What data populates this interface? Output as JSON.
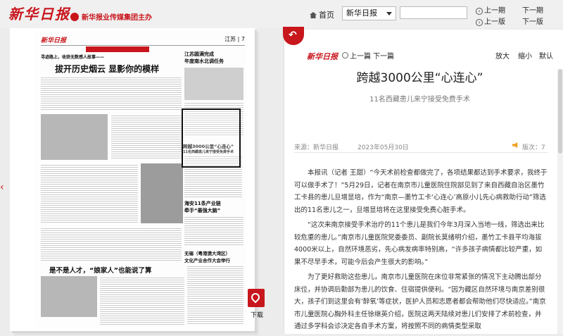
{
  "header": {
    "logo_text": "新华日报",
    "brand_text": "新华报业传媒集团主办",
    "home_label": "首页",
    "paper_select_value": "新华日报",
    "search_placeholder": "",
    "prev_issue": "上一期",
    "next_issue": "下一期",
    "prev_page": "上一版",
    "next_page": "下一版"
  },
  "newspaper": {
    "logo_text": "新华日报",
    "section_label": "江苏",
    "page_number": "7",
    "headline_main": "拔开历史烟云 显影你的模样",
    "headline_top": "寻迹路上，收获无数感人故事——",
    "headline_right1": "江苏圆满完成",
    "headline_right2": "年度南水北调任务",
    "highlight_title": "跨越3000公里“心连心”",
    "highlight_sub": "11名西藏患儿来宁接受免费手术",
    "headline_mid": "海安11条产业链",
    "headline_mid2": "牵手“最强大脑”",
    "headline_low1": "无锡（粤港澳大湾区）",
    "headline_low2": "文化产业合作大会举行",
    "headline_bottom": "是不是人才，“娘家人”也能说了算",
    "download_label": "下载"
  },
  "article": {
    "panel_logo": "新华日报",
    "prev_article": "上一篇",
    "next_article": "下一篇",
    "zoom_in": "放大",
    "zoom_out": "缩小",
    "reset": "默认",
    "title": "跨越3000公里“心连心”",
    "subtitle": "11名西藏患儿来宁接受免费手术",
    "source": "来源：新华日报",
    "date": "2023年05月30日",
    "edition": "版次：7",
    "paragraphs": [
      "本报讯（记者 王甜）“今天术前检查都做完了，各项结果都达到手术要求，我终于可以做手术了！”5月29日，记者在南京市儿童医院住院部见到了来自西藏自治区墨竹工卡县的患儿旦增显培，作为“南京—墨竹工卡‘心连心’高原小儿先心病救助行动”筛选出的11名患儿之一，旦增显培将在这里接受免费心脏手术。",
      "“这次来南京接受手术治疗的11个患儿是我们今年3月深入当地一线，筛选出来比较危重的患儿。”南京市儿童医院党委委员、副院长莫绪明介绍，墨竹工卡县平均海拔4000米以上，自然环境恶劣，先心病发病率特别高，“许多孩子病情都比较严重，如果不尽早手术，可能今后会产生很大的影响。”",
      "为了更好救助这些患儿，南京市儿童医院在床位非常紧张的情况下主动腾出部分床位，并协调后勤部为患儿的饮食、住宿提供便利。“因为藏区自然环境与南京差别很大，孩子们到这里会有‘醉氧’等症状，医护人员和志愿者都会帮助他们尽快适应。”南京市儿童医院心胸外科主任徐继英介绍，医院这两天陆续对患儿们安排了术前检查，并通过多学科会诊决定各自手术方案，将按照不同的病情类型采取"
    ]
  }
}
